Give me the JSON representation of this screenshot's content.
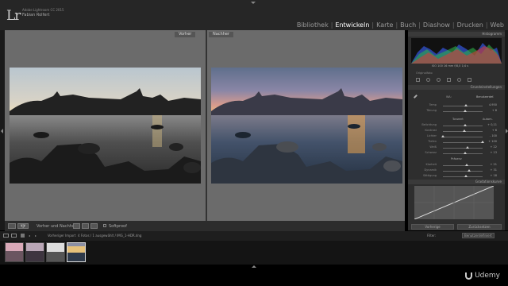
{
  "header": {
    "logo": "Lr",
    "product": "Adobe Lightroom CC 2015",
    "user": "Fabian Rolfert"
  },
  "modules": [
    {
      "label": "Bibliothek",
      "active": false
    },
    {
      "label": "Entwickeln",
      "active": true
    },
    {
      "label": "Karte",
      "active": false
    },
    {
      "label": "Buch",
      "active": false
    },
    {
      "label": "Diashow",
      "active": false
    },
    {
      "label": "Drucken",
      "active": false
    },
    {
      "label": "Web",
      "active": false
    }
  ],
  "compare": {
    "before_label": "Vorher",
    "after_label": "Nachher"
  },
  "toolbar": {
    "view_label": "Vorher und Nachher:",
    "softproof_label": "Softproof"
  },
  "panel": {
    "histogram_title": "Histogramm",
    "exif": "ISO 100   16 mm   f/8,0   1/4 s",
    "original_photo": "Originalfoto",
    "basic_title": "Grundeinstellungen",
    "wb_label": "WA:",
    "wb_value": "Benutzerdef.",
    "tone_title": "Tonwert",
    "tone_auto": "Autom.",
    "presence_title": "Präsenz",
    "curve_title": "Gradationskurve",
    "prev_button": "Vorherige",
    "reset_button": "Zurücksetzen",
    "sliders_wb": [
      {
        "label": "Temp",
        "value": "4.950",
        "pos": 0.58
      },
      {
        "label": "Tönung",
        "value": "+ 8",
        "pos": 0.56
      }
    ],
    "sliders_tone": [
      {
        "label": "Belichtung",
        "value": "+ 0,11",
        "pos": 0.55
      },
      {
        "label": "Kontrast",
        "value": "+ 6",
        "pos": 0.53
      },
      {
        "label": "Lichter",
        "value": "- 100",
        "pos": 0.0
      },
      {
        "label": "Tiefen",
        "value": "+ 100",
        "pos": 1.0
      },
      {
        "label": "Weiß",
        "value": "+ 22",
        "pos": 0.61
      },
      {
        "label": "Schwarz",
        "value": "+ 13",
        "pos": 0.56
      }
    ],
    "sliders_presence": [
      {
        "label": "Klarheit",
        "value": "+ 21",
        "pos": 0.6
      },
      {
        "label": "Dynamik",
        "value": "+ 31",
        "pos": 0.65
      },
      {
        "label": "Sättigung",
        "value": "+ 18",
        "pos": 0.58
      }
    ]
  },
  "filmstrip_bar": {
    "source": "Vorheriger Import",
    "count": "4 Fotos / 1 ausgewählt / IMG_1-HDR.dng",
    "filter_label": "Filter:",
    "filter_value": "Benutzerdefiniert"
  },
  "watermark": "Udemy"
}
